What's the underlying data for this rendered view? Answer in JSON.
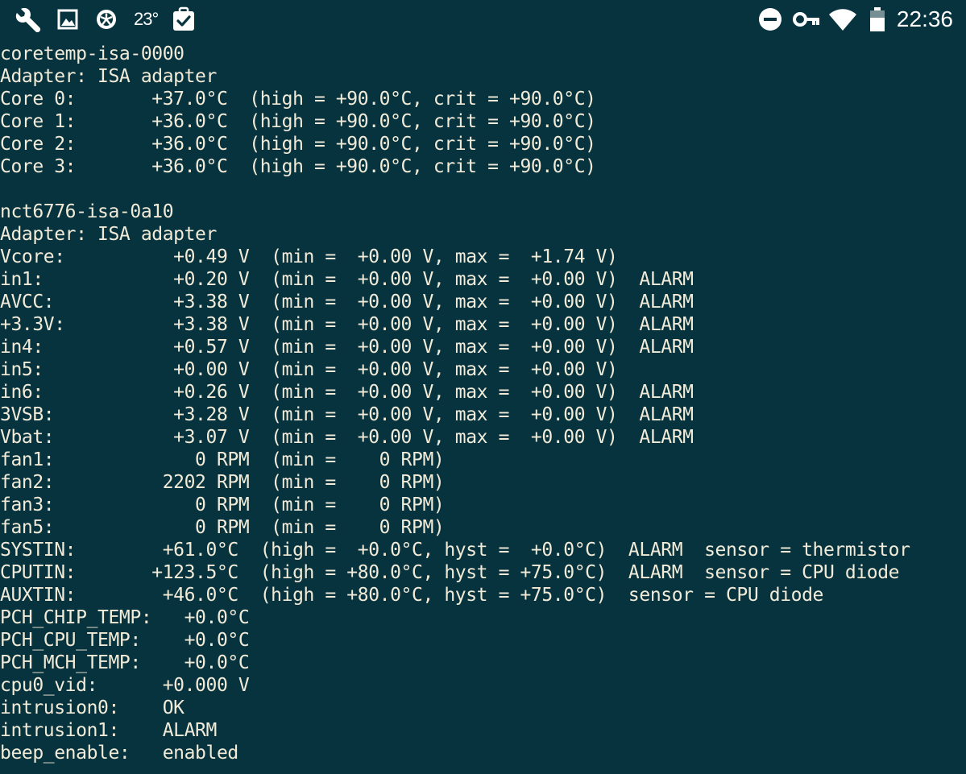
{
  "status_bar": {
    "left_icons": [
      "wrench-icon",
      "image-icon",
      "weather-icon",
      "temperature-text",
      "clipboard-check-icon"
    ],
    "temperature": "23°",
    "right_icons": [
      "do-not-disturb-icon",
      "vpn-key-icon",
      "wifi-icon",
      "battery-icon"
    ],
    "clock": "22:36"
  },
  "terminal": {
    "lines": [
      "coretemp-isa-0000",
      "Adapter: ISA adapter",
      "Core 0:       +37.0°C  (high = +90.0°C, crit = +90.0°C)",
      "Core 1:       +36.0°C  (high = +90.0°C, crit = +90.0°C)",
      "Core 2:       +36.0°C  (high = +90.0°C, crit = +90.0°C)",
      "Core 3:       +36.0°C  (high = +90.0°C, crit = +90.0°C)",
      "",
      "nct6776-isa-0a10",
      "Adapter: ISA adapter",
      "Vcore:          +0.49 V  (min =  +0.00 V, max =  +1.74 V)",
      "in1:            +0.20 V  (min =  +0.00 V, max =  +0.00 V)  ALARM",
      "AVCC:           +3.38 V  (min =  +0.00 V, max =  +0.00 V)  ALARM",
      "+3.3V:          +3.38 V  (min =  +0.00 V, max =  +0.00 V)  ALARM",
      "in4:            +0.57 V  (min =  +0.00 V, max =  +0.00 V)  ALARM",
      "in5:            +0.00 V  (min =  +0.00 V, max =  +0.00 V)",
      "in6:            +0.26 V  (min =  +0.00 V, max =  +0.00 V)  ALARM",
      "3VSB:           +3.28 V  (min =  +0.00 V, max =  +0.00 V)  ALARM",
      "Vbat:           +3.07 V  (min =  +0.00 V, max =  +0.00 V)  ALARM",
      "fan1:             0 RPM  (min =    0 RPM)",
      "fan2:          2202 RPM  (min =    0 RPM)",
      "fan3:             0 RPM  (min =    0 RPM)",
      "fan5:             0 RPM  (min =    0 RPM)",
      "SYSTIN:        +61.0°C  (high =  +0.0°C, hyst =  +0.0°C)  ALARM  sensor = thermistor",
      "CPUTIN:       +123.5°C  (high = +80.0°C, hyst = +75.0°C)  ALARM  sensor = CPU diode",
      "AUXTIN:        +46.0°C  (high = +80.0°C, hyst = +75.0°C)  sensor = CPU diode",
      "PCH_CHIP_TEMP:   +0.0°C",
      "PCH_CPU_TEMP:    +0.0°C",
      "PCH_MCH_TEMP:    +0.0°C",
      "cpu0_vid:      +0.000 V",
      "intrusion0:    OK",
      "intrusion1:    ALARM",
      "beep_enable:   enabled"
    ]
  },
  "colors": {
    "background": "#07333f",
    "text": "#f1ebd8",
    "status_icons": "#ffffff"
  }
}
